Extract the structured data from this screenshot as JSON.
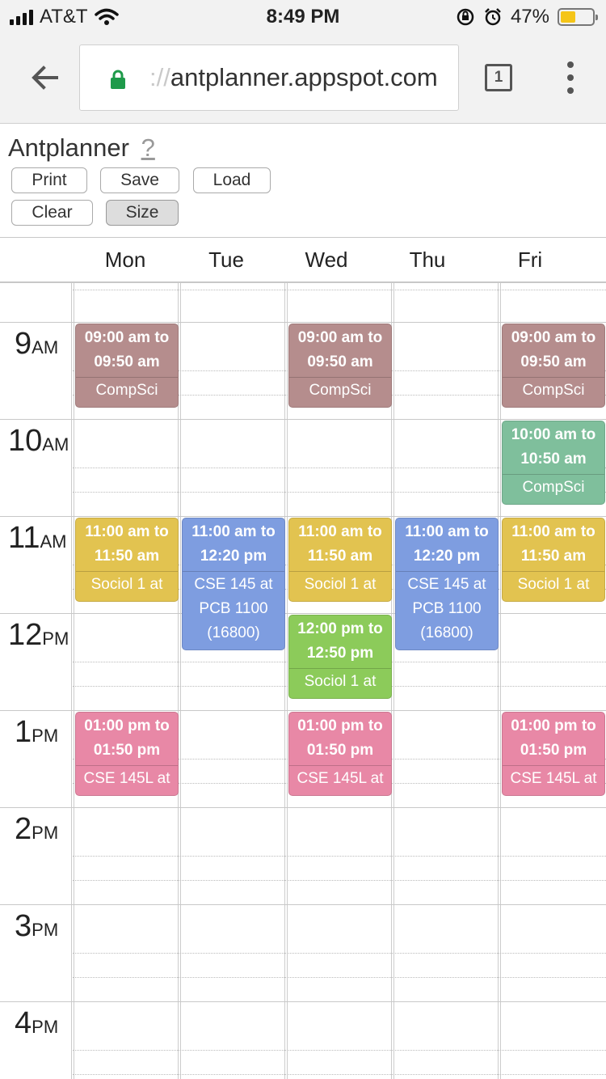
{
  "status_bar": {
    "carrier": "AT&T",
    "time": "8:49 PM",
    "battery": "47%",
    "battery_level": 0.47
  },
  "browser": {
    "url_prefix": "://",
    "url_host": "antplanner.appspot.com",
    "tab_count": "1"
  },
  "app": {
    "title": "Antplanner",
    "help": "?",
    "buttons": {
      "print": "Print",
      "save": "Save",
      "load": "Load",
      "clear": "Clear",
      "size": "Size"
    }
  },
  "calendar": {
    "days": [
      "Mon",
      "Tue",
      "Wed",
      "Thu",
      "Fri"
    ],
    "hours": [
      {
        "num": "9",
        "suffix": "AM"
      },
      {
        "num": "10",
        "suffix": "AM"
      },
      {
        "num": "11",
        "suffix": "AM"
      },
      {
        "num": "12",
        "suffix": "PM"
      },
      {
        "num": "1",
        "suffix": "PM"
      },
      {
        "num": "2",
        "suffix": "PM"
      },
      {
        "num": "3",
        "suffix": "PM"
      },
      {
        "num": "4",
        "suffix": "PM"
      }
    ],
    "events": [
      {
        "day": "Mon",
        "time": "09:00 am to 09:50 am",
        "desc": "CompSci",
        "color": "#b58d8d"
      },
      {
        "day": "Wed",
        "time": "09:00 am to 09:50 am",
        "desc": "CompSci",
        "color": "#b58d8d"
      },
      {
        "day": "Fri",
        "time": "09:00 am to 09:50 am",
        "desc": "CompSci",
        "color": "#b58d8d"
      },
      {
        "day": "Fri",
        "time": "10:00 am to 10:50 am",
        "desc": "CompSci",
        "color": "#7fbf9c"
      },
      {
        "day": "Mon",
        "time": "11:00 am to 11:50 am",
        "desc": "Sociol 1 at",
        "color": "#e2c350"
      },
      {
        "day": "Tue",
        "time": "11:00 am to 12:20 pm",
        "desc": "CSE 145 at PCB 1100 (16800)",
        "color": "#7e9de0"
      },
      {
        "day": "Wed",
        "time": "11:00 am to 11:50 am",
        "desc": "Sociol 1 at",
        "color": "#e2c350"
      },
      {
        "day": "Thu",
        "time": "11:00 am to 12:20 pm",
        "desc": "CSE 145 at PCB 1100 (16800)",
        "color": "#7e9de0"
      },
      {
        "day": "Fri",
        "time": "11:00 am to 11:50 am",
        "desc": "Sociol 1 at",
        "color": "#e2c350"
      },
      {
        "day": "Wed",
        "time": "12:00 pm to 12:50 pm",
        "desc": "Sociol 1 at",
        "color": "#8ccb5a"
      },
      {
        "day": "Mon",
        "time": "01:00 pm to 01:50 pm",
        "desc": "CSE 145L at",
        "color": "#e888a6"
      },
      {
        "day": "Wed",
        "time": "01:00 pm to 01:50 pm",
        "desc": "CSE 145L at",
        "color": "#e888a6"
      },
      {
        "day": "Fri",
        "time": "01:00 pm to 01:50 pm",
        "desc": "CSE 145L at",
        "color": "#e888a6"
      }
    ]
  }
}
